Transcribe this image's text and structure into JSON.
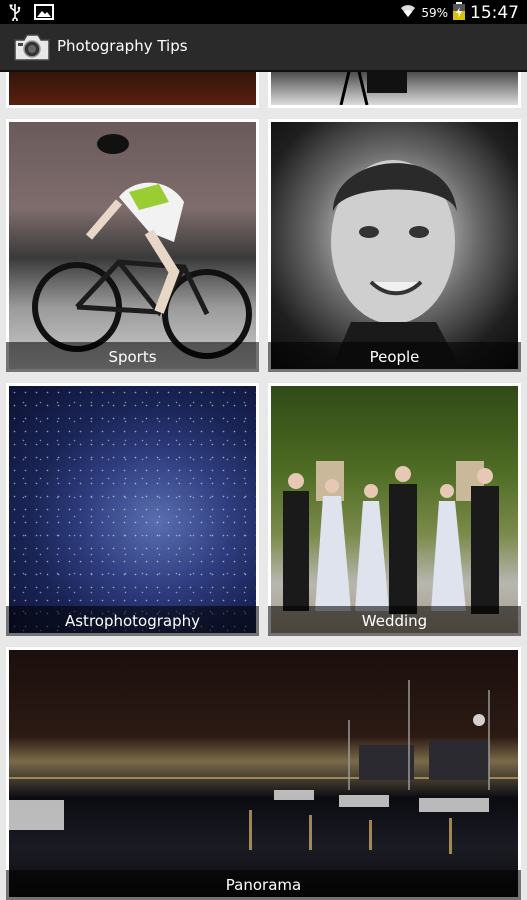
{
  "status_bar": {
    "battery": "59%",
    "time": "15:47",
    "icons": [
      "usb-icon",
      "image-icon",
      "wifi-icon",
      "battery-icon"
    ]
  },
  "action_bar": {
    "title": "Photography Tips",
    "icon": "camera-app-icon"
  },
  "tiles": [
    {
      "label": ""
    },
    {
      "label": ""
    },
    {
      "label": "Sports"
    },
    {
      "label": "People"
    },
    {
      "label": "Astrophotography"
    },
    {
      "label": "Wedding"
    },
    {
      "label": "Panorama"
    }
  ],
  "colors": {
    "status_bar_bg": "#000000",
    "action_bar_bg": "#2a2a2a",
    "page_bg": "#e8e8e8",
    "tile_border": "#ffffff"
  }
}
